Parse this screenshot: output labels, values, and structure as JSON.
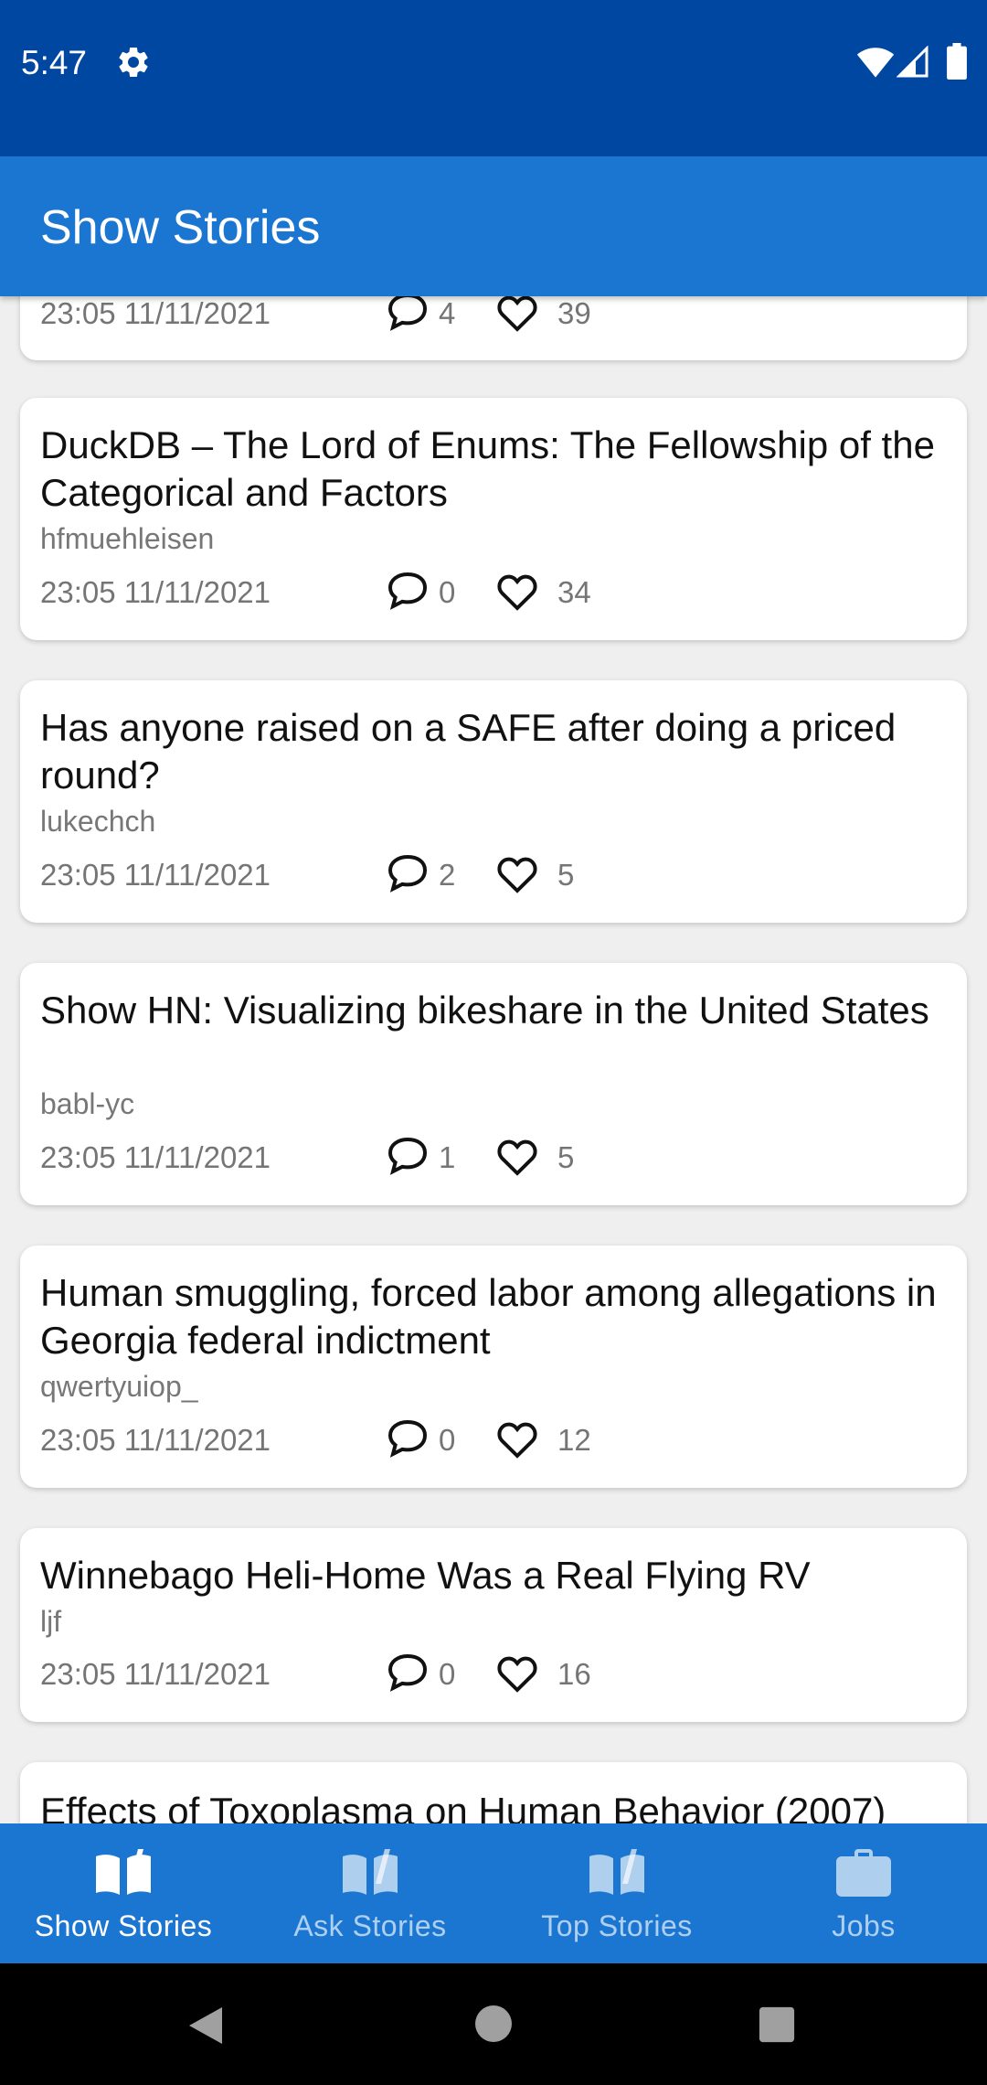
{
  "status_bar": {
    "time": "5:47",
    "icons": [
      "settings-icon",
      "wifi-icon",
      "signal-icon",
      "battery-icon"
    ]
  },
  "app_bar": {
    "title": "Show Stories"
  },
  "stories": [
    {
      "title": "",
      "author": "",
      "date": "23:05 11/11/2021",
      "comments": "4",
      "likes": "39"
    },
    {
      "title": "DuckDB – The Lord of Enums: The Fellowship of the Categorical and Factors",
      "author": "hfmuehleisen",
      "date": "23:05 11/11/2021",
      "comments": "0",
      "likes": "34"
    },
    {
      "title": "Has anyone raised on a SAFE after doing a priced round?",
      "author": "lukechch",
      "date": "23:05 11/11/2021",
      "comments": "2",
      "likes": "5"
    },
    {
      "title": "Show HN: Visualizing bikeshare in the United States",
      "author": "babl-yc",
      "date": "23:05 11/11/2021",
      "comments": "1",
      "likes": "5"
    },
    {
      "title": "Human smuggling, forced labor among allegations in Georgia federal indictment",
      "author": "qwertyuiop_",
      "date": "23:05 11/11/2021",
      "comments": "0",
      "likes": "12"
    },
    {
      "title": "Winnebago Heli-Home Was a Real Flying RV",
      "author": "ljf",
      "date": "23:05 11/11/2021",
      "comments": "0",
      "likes": "16"
    },
    {
      "title": "Effects of Toxoplasma on Human Behavior (2007)",
      "author": "",
      "date": "",
      "comments": "",
      "likes": ""
    }
  ],
  "bottom_nav": [
    {
      "label": "Show Stories",
      "icon": "book-open-icon",
      "active": true
    },
    {
      "label": "Ask Stories",
      "icon": "book-open-icon",
      "active": false
    },
    {
      "label": "Top Stories",
      "icon": "book-open-icon",
      "active": false
    },
    {
      "label": "Jobs",
      "icon": "briefcase-icon",
      "active": false
    }
  ],
  "system_nav": [
    "back-icon",
    "home-icon",
    "recents-icon"
  ],
  "colors": {
    "status_bar": "#0047a1",
    "app_bar": "#1b76d2",
    "background": "#efefef",
    "card": "#ffffff",
    "secondary_text": "#757575"
  }
}
